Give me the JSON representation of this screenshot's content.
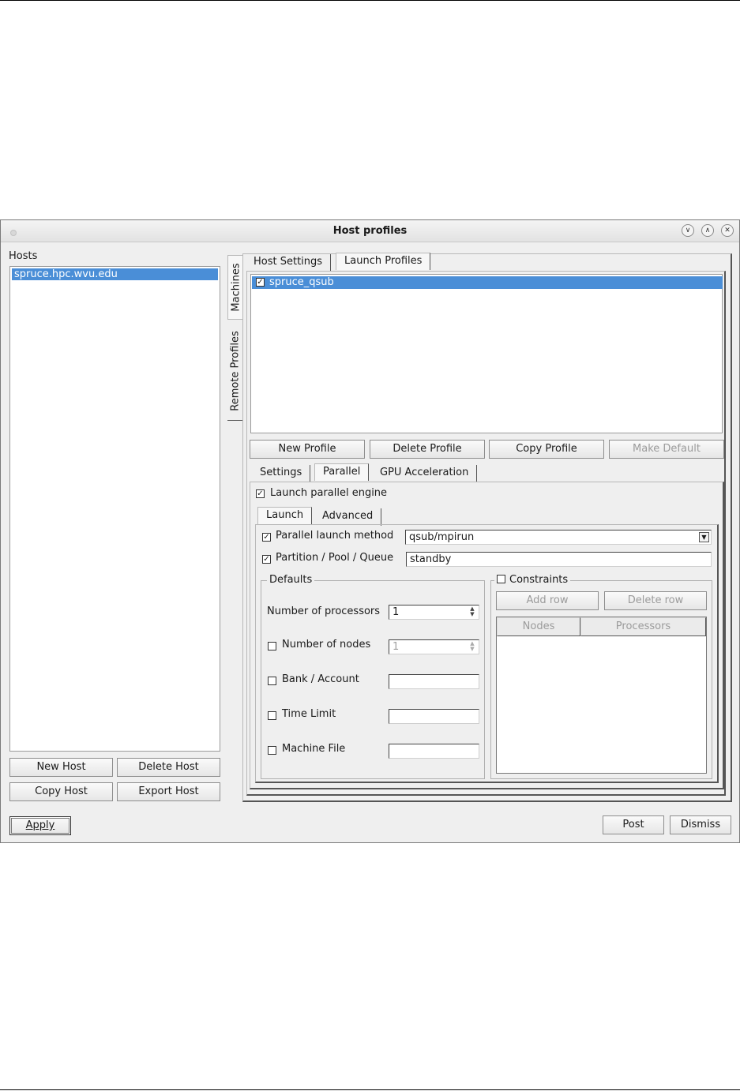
{
  "window": {
    "title": "Host profiles",
    "controls": [
      "minimize-icon",
      "maximize-icon",
      "close-icon"
    ]
  },
  "hosts": {
    "label": "Hosts",
    "items": [
      "spruce.hpc.wvu.edu"
    ],
    "selected": "spruce.hpc.wvu.edu",
    "buttons": {
      "new": "New Host",
      "delete": "Delete Host",
      "copy": "Copy Host",
      "export": "Export Host"
    }
  },
  "side_tabs": [
    "Machines",
    "Remote Profiles"
  ],
  "top_tabs": [
    "Host Settings",
    "Launch Profiles"
  ],
  "profiles": {
    "items": [
      {
        "name": "spruce_qsub",
        "checked": true
      }
    ],
    "buttons": {
      "new": "New Profile",
      "delete": "Delete Profile",
      "copy": "Copy Profile",
      "make_default": "Make Default"
    }
  },
  "profile_tabs": [
    "Settings",
    "Parallel",
    "GPU Acceleration"
  ],
  "parallel": {
    "launch_engine": {
      "label": "Launch parallel engine",
      "checked": true
    },
    "subtabs": [
      "Launch",
      "Advanced"
    ],
    "launch_method": {
      "label": "Parallel launch method",
      "checked": true,
      "value": "qsub/mpirun"
    },
    "partition": {
      "label": "Partition / Pool / Queue",
      "checked": true,
      "value": "standby"
    },
    "defaults": {
      "title": "Defaults",
      "num_processors": {
        "label": "Number of processors",
        "value": "1"
      },
      "num_nodes": {
        "label": "Number of nodes",
        "checked": false,
        "value": "1"
      },
      "bank": {
        "label": "Bank / Account",
        "checked": false,
        "value": ""
      },
      "time_limit": {
        "label": "Time Limit",
        "checked": false,
        "value": ""
      },
      "machine_file": {
        "label": "Machine File",
        "checked": false,
        "value": ""
      }
    },
    "constraints": {
      "title": "Constraints",
      "checked": false,
      "add_row": "Add row",
      "delete_row": "Delete row",
      "columns": [
        "Nodes",
        "Processors"
      ]
    }
  },
  "footer": {
    "apply": "Apply",
    "post": "Post",
    "dismiss": "Dismiss"
  }
}
